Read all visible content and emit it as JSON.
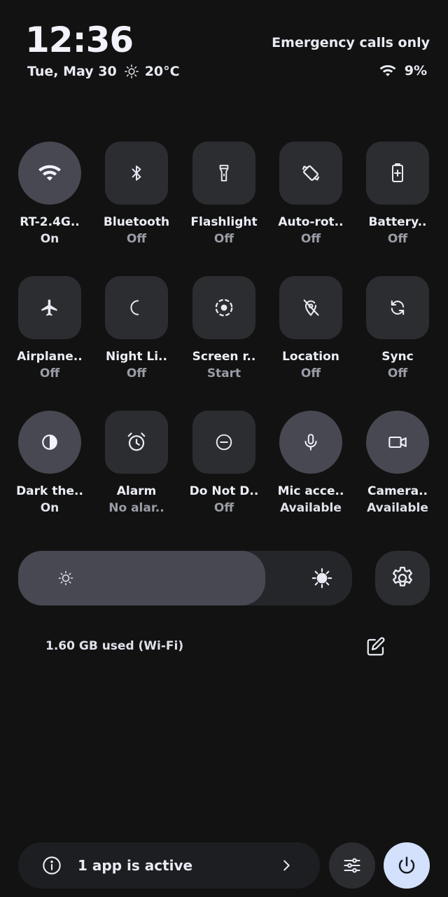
{
  "status": {
    "time": "12:36",
    "date": "Tue, May 30",
    "weather_icon": "sun-icon",
    "temperature": "20°C",
    "carrier": "Emergency calls only",
    "battery": "9%"
  },
  "tiles": [
    {
      "label": "RT-2.4G..",
      "state": "On",
      "icon": "wifi-icon",
      "on": true
    },
    {
      "label": "Bluetooth",
      "state": "Off",
      "icon": "bluetooth-icon"
    },
    {
      "label": "Flashlight",
      "state": "Off",
      "icon": "flashlight-icon"
    },
    {
      "label": "Auto-rot..",
      "state": "Off",
      "icon": "auto-rotate-icon"
    },
    {
      "label": "Battery..",
      "state": "Off",
      "icon": "battery-saver-icon"
    },
    {
      "label": "Airplane..",
      "state": "Off",
      "icon": "airplane-icon"
    },
    {
      "label": "Night Li..",
      "state": "Off",
      "icon": "moon-icon"
    },
    {
      "label": "Screen r..",
      "state": "Start",
      "icon": "screen-record-icon"
    },
    {
      "label": "Location",
      "state": "Off",
      "icon": "location-off-icon"
    },
    {
      "label": "Sync",
      "state": "Off",
      "icon": "sync-icon"
    },
    {
      "label": "Dark the..",
      "state": "On",
      "icon": "dark-theme-icon",
      "on": true
    },
    {
      "label": "Alarm",
      "state": "No alar..",
      "icon": "alarm-icon"
    },
    {
      "label": "Do Not D..",
      "state": "Off",
      "icon": "do-not-disturb-icon"
    },
    {
      "label": "Mic acce..",
      "state": "Available",
      "icon": "microphone-icon",
      "on": true
    },
    {
      "label": "Camera..",
      "state": "Available",
      "icon": "camera-icon",
      "on": true
    }
  ],
  "brightness": {
    "level_percent": 74
  },
  "data_usage": "1.60 GB used (Wi-Fi)",
  "footer": {
    "active_apps": "1 app is active"
  },
  "colors": {
    "background": "#121212",
    "tile": "#2c2d31",
    "tile_on": "#474851",
    "power_button": "#d3e1fd"
  }
}
